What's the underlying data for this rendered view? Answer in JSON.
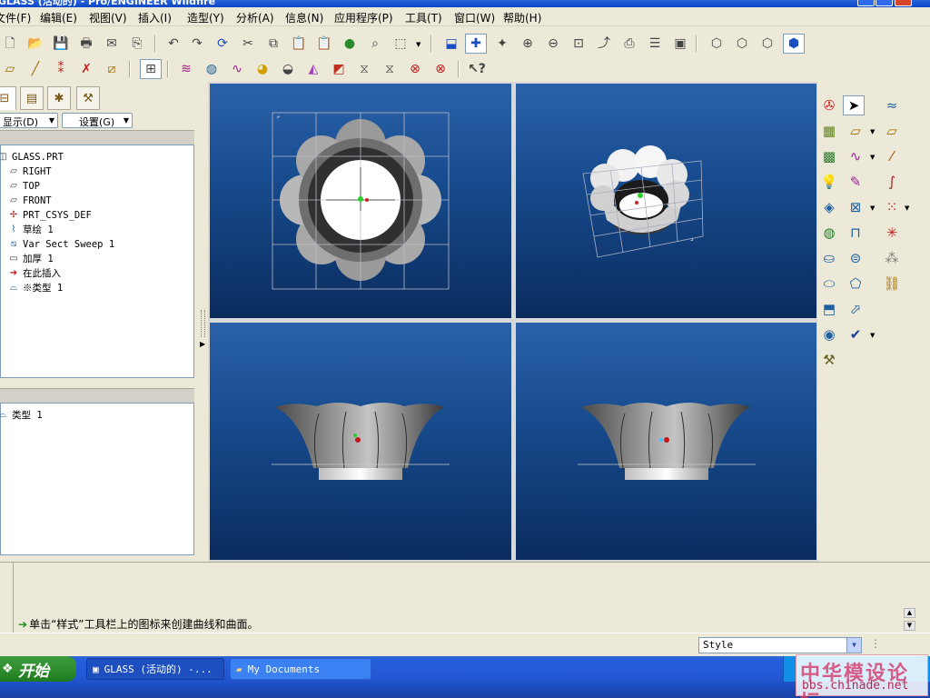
{
  "window": {
    "title": "GLASS (活动的) - Pro/ENGINEER Wildfire"
  },
  "menu": {
    "items": [
      "文件(F)",
      "编辑(E)",
      "视图(V)",
      "插入(I)",
      "造型(Y)",
      "分析(A)",
      "信息(N)",
      "应用程序(P)",
      "工具(T)",
      "窗口(W)",
      "帮助(H)"
    ],
    "right_help": "?"
  },
  "toolbar1": {
    "icons": [
      "new-file-icon",
      "open-icon",
      "save-icon",
      "print-icon",
      "send-icon",
      "cut-copy-icon",
      "undo-icon",
      "redo-icon",
      "regenerate-icon",
      "cut-icon",
      "copy-icon",
      "paste-icon",
      "paste-special-icon",
      "model-player-icon",
      "binoculars-icon",
      "select-box-icon",
      "refit-icon",
      "datum-axis-toggle-icon",
      "spin-center-icon",
      "zoom-in-icon",
      "zoom-out-icon",
      "fit-icon",
      "reorient-icon",
      "saved-views-icon",
      "layers-icon",
      "view-manager-icon",
      "wireframe-icon",
      "hidden-line-icon",
      "no-hidden-icon",
      "shading-icon"
    ]
  },
  "toolbar2": {
    "icons": [
      "style-sketch-icon",
      "style-datum-icon",
      "style-points-icon",
      "style-csys-icon",
      "style-plane-icon",
      "view-display-icon",
      "curvature-icon",
      "section-icon",
      "reflection-icon",
      "shade-icon",
      "draft-icon",
      "slope-icon",
      "deviation-icon",
      "offset-icon",
      "delete-analysis-icon",
      "remove-all-analysis-icon",
      "whats-this-icon"
    ]
  },
  "left_panel": {
    "display_menu": "显示(D)",
    "settings_menu": "设置(G)",
    "tree": [
      {
        "label": "GLASS.PRT",
        "icon": "part-icon"
      },
      {
        "label": "RIGHT",
        "icon": "datum-plane-icon"
      },
      {
        "label": "TOP",
        "icon": "datum-plane-icon"
      },
      {
        "label": "FRONT",
        "icon": "datum-plane-icon"
      },
      {
        "label": "PRT_CSYS_DEF",
        "icon": "csys-icon"
      },
      {
        "label": "草绘 1",
        "icon": "sketch-icon"
      },
      {
        "label": "Var Sect Sweep 1",
        "icon": "sweep-icon"
      },
      {
        "label": "加厚 1",
        "icon": "thicken-icon"
      },
      {
        "label": "在此插入",
        "icon": "insert-here-icon"
      },
      {
        "label": "※类型 1",
        "icon": "style-feature-icon"
      }
    ],
    "props": [
      {
        "label": "类型 1",
        "icon": "style-feature-icon"
      }
    ]
  },
  "right_toolbar": {
    "icons": [
      "appearance-icon",
      "select-arrow-icon",
      "style-tools-icon",
      "set-active-plane-icon",
      "internal-plane-icon",
      "shade-icon",
      "curve-icon",
      "curve-dropdown-icon",
      "datum-curve-icon",
      "point-light-icon",
      "pen-curve-icon",
      "sketch-curve-icon",
      "free-curve-icon",
      "surface-icon",
      "trim-icon",
      "trim-toggle-icon",
      "connect-icon",
      "boundary-surface-icon",
      "edit-curve-icon",
      "loft-icon",
      "split-icon",
      "shell-icon",
      "curve-from-surface-icon",
      "ok-check-icon",
      "cancel-icon",
      "analysis-icon"
    ]
  },
  "message": {
    "text": "单击“样式”工具栏上的图标来创建曲线和曲面。"
  },
  "status": {
    "filter_value": "Style"
  },
  "taskbar": {
    "start_label": "开始",
    "tasks": [
      {
        "label": "GLASS (活动的) -..."
      },
      {
        "label": "My Documents"
      }
    ]
  },
  "watermark": {
    "line1": "中华模设论坛",
    "line2": "bbs.chinade.net"
  }
}
